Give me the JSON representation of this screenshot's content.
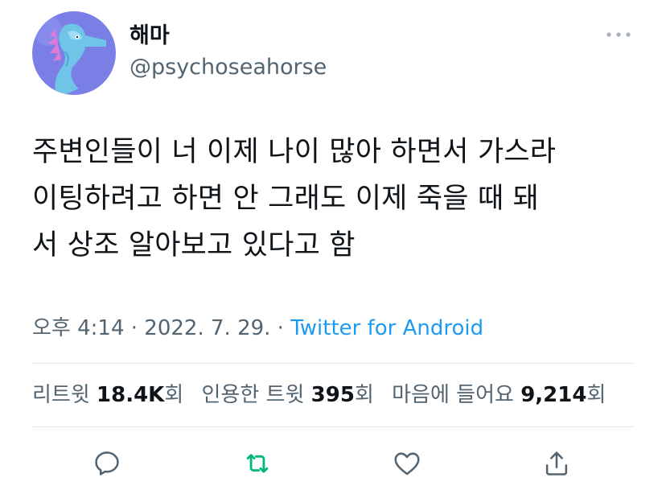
{
  "author": {
    "display_name": "해마",
    "handle": "@psychoseahorse",
    "avatar_icon": "seahorse-avatar"
  },
  "tweet": {
    "lines": [
      "주변인들이 너 이제 나이 많아 하면서 가스라",
      "이팅하려고 하면 안 그래도 이제 죽을 때 돼",
      "서 상조 알아보고 있다고 함"
    ]
  },
  "meta": {
    "time": "오후 4:14",
    "sep1": " · ",
    "date": "2022. 7. 29.",
    "sep2": " · ",
    "source": "Twitter for Android"
  },
  "stats": {
    "retweets_label": "리트윗 ",
    "retweets": "18.4K",
    "retweets_suffix": "회",
    "quotes_label": "인용한 트윗 ",
    "quotes": "395",
    "quotes_suffix": "회",
    "likes_label": "마음에 들어요 ",
    "likes": "9,214",
    "likes_suffix": "회"
  },
  "actions": {
    "reply_icon": "reply-icon",
    "retweet_icon": "retweet-icon",
    "like_icon": "heart-icon",
    "share_icon": "share-icon"
  },
  "colors": {
    "accent": "#1d9bf0",
    "retweet": "#00ba7c",
    "secondary_text": "#536471",
    "avatar_bg": "#7a7fe6"
  }
}
